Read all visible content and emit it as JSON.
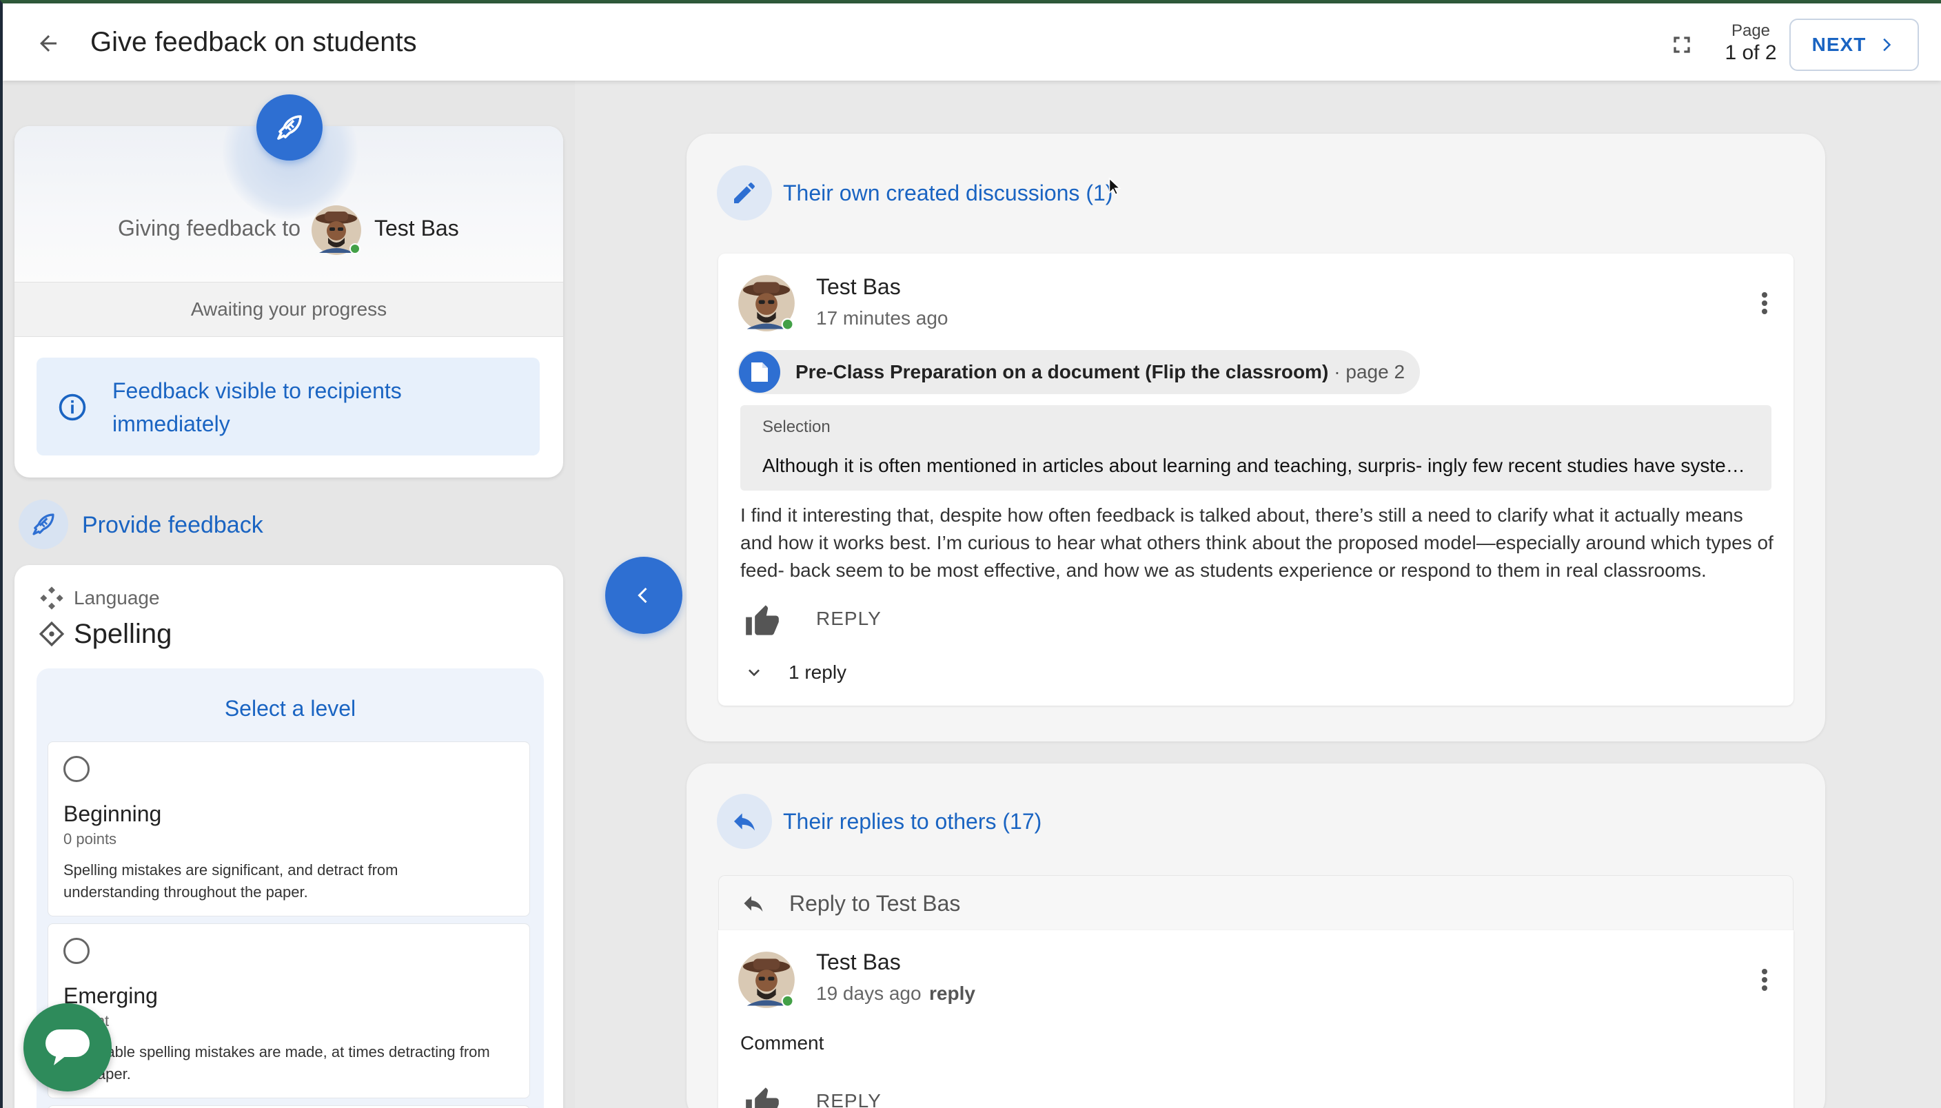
{
  "header": {
    "title": "Give feedback on students",
    "page_label": "Page",
    "page_count": "1 of 2",
    "next_label": "NEXT",
    "icons": [
      "arrow-left-icon",
      "fullscreen-icon",
      "chevron-right-icon"
    ]
  },
  "giver": {
    "label": "Giving feedback to",
    "student_name": "Test Bas",
    "progress": "Awaiting your progress",
    "visibility_note": "Feedback visible to recipients immediately"
  },
  "provide": {
    "label": "Provide feedback"
  },
  "rubric": {
    "category": "Language",
    "criterion": "Spelling",
    "select_prompt": "Select a level",
    "levels": [
      {
        "name": "Beginning",
        "points": "0 points",
        "description": "Spelling mistakes are significant, and detract from understanding throughout the paper."
      },
      {
        "name": "Emerging",
        "points": "1 point",
        "description": "Noticeable spelling mistakes are made, at times detracting from the paper."
      }
    ]
  },
  "discussions": {
    "title": "Their own created discussions (1)",
    "post": {
      "author": "Test Bas",
      "time": "17 minutes ago",
      "doc_name": "Pre-Class Preparation on a document (Flip the classroom)",
      "doc_page": "· page 2",
      "selection_label": "Selection",
      "selection_text": "Although it is often mentioned in articles about learning and teaching, surpris- ingly few recent studies have system...",
      "body": "I find it interesting that, despite how often feedback is talked about, there’s still a need to clarify what it actually means and how it works best. I’m curious to hear what others think about the proposed model—especially around which types of feed- back seem to be most effective, and how we as students experience or respond to them in real classrooms.",
      "reply_label": "REPLY",
      "replies_count": "1 reply"
    }
  },
  "replies": {
    "title": "Their replies to others (17)",
    "reply_to": "Reply to Test Bas",
    "post": {
      "author": "Test Bas",
      "time": "19 days ago",
      "reply_link": "reply",
      "comment": "Comment",
      "reply_label": "REPLY"
    }
  },
  "colors": {
    "accent": "#1a64c2",
    "accent_fill": "#2e6fd2",
    "chat_button": "#2e8b5b",
    "online_dot": "#43a047"
  }
}
